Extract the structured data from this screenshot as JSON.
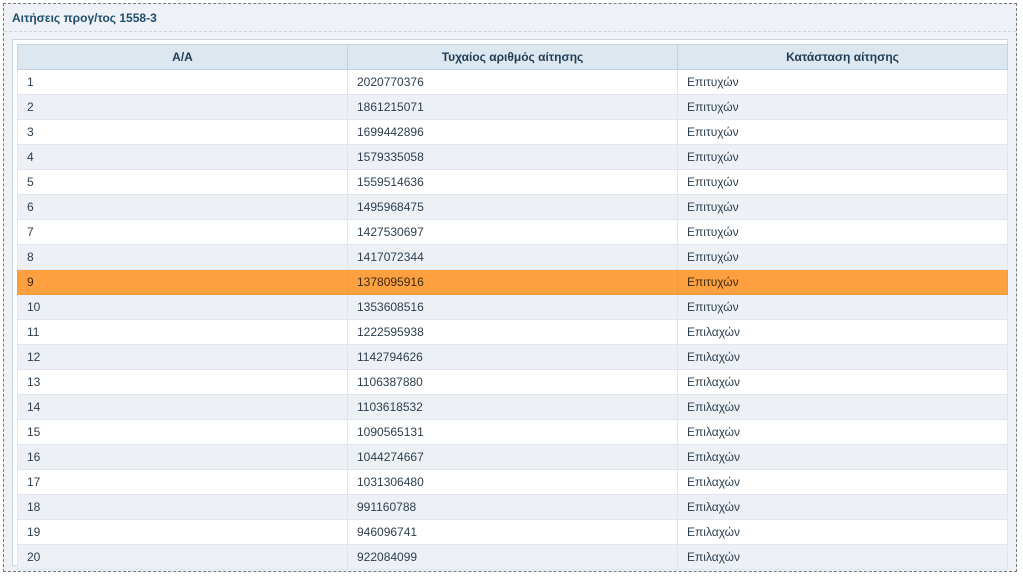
{
  "panel": {
    "title": "Αιτήσεις προγ/τος 1558-3"
  },
  "table": {
    "columns": [
      "Α/Α",
      "Τυχαίος αριθμός αίτησης",
      "Κατάσταση αίτησης"
    ],
    "selected_row": 9,
    "selected_color": "#ffa040",
    "rows": [
      {
        "aa": "1",
        "number": "2020770376",
        "status": "Επιτυχών"
      },
      {
        "aa": "2",
        "number": "1861215071",
        "status": "Επιτυχών"
      },
      {
        "aa": "3",
        "number": "1699442896",
        "status": "Επιτυχών"
      },
      {
        "aa": "4",
        "number": "1579335058",
        "status": "Επιτυχών"
      },
      {
        "aa": "5",
        "number": "1559514636",
        "status": "Επιτυχών"
      },
      {
        "aa": "6",
        "number": "1495968475",
        "status": "Επιτυχών"
      },
      {
        "aa": "7",
        "number": "1427530697",
        "status": "Επιτυχών"
      },
      {
        "aa": "8",
        "number": "1417072344",
        "status": "Επιτυχών"
      },
      {
        "aa": "9",
        "number": "1378095916",
        "status": "Επιτυχών"
      },
      {
        "aa": "10",
        "number": "1353608516",
        "status": "Επιτυχών"
      },
      {
        "aa": "11",
        "number": "1222595938",
        "status": "Επιλαχών"
      },
      {
        "aa": "12",
        "number": "1142794626",
        "status": "Επιλαχών"
      },
      {
        "aa": "13",
        "number": "1106387880",
        "status": "Επιλαχών"
      },
      {
        "aa": "14",
        "number": "1103618532",
        "status": "Επιλαχών"
      },
      {
        "aa": "15",
        "number": "1090565131",
        "status": "Επιλαχών"
      },
      {
        "aa": "16",
        "number": "1044274667",
        "status": "Επιλαχών"
      },
      {
        "aa": "17",
        "number": "1031306480",
        "status": "Επιλαχών"
      },
      {
        "aa": "18",
        "number": "991160788",
        "status": "Επιλαχών"
      },
      {
        "aa": "19",
        "number": "946096741",
        "status": "Επιλαχών"
      },
      {
        "aa": "20",
        "number": "922084099",
        "status": "Επιλαχών"
      }
    ]
  }
}
